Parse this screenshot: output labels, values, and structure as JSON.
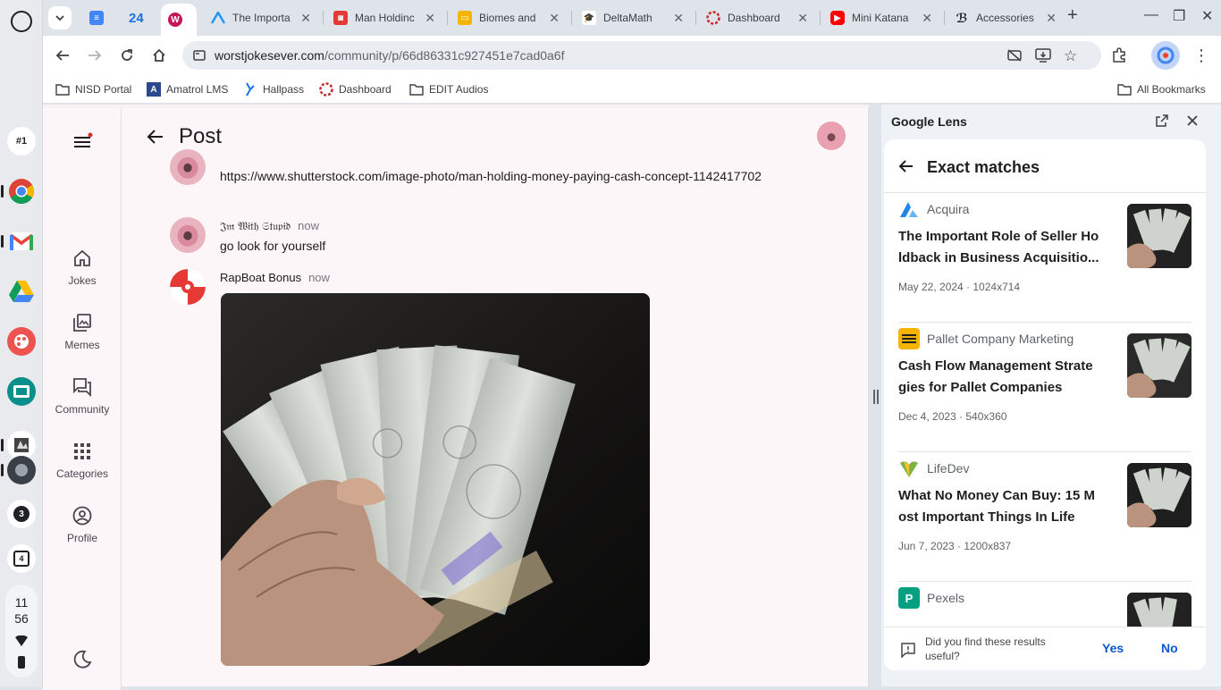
{
  "shelf": {
    "apps": [
      "launcher",
      "notification-badge",
      "chrome",
      "gmail",
      "google-drive",
      "paint-app",
      "classroom-app",
      "photo-app",
      "badge-3",
      "calendar-4"
    ],
    "badge_1": "#1",
    "badge_3": "3",
    "calendar_day": "4",
    "clock_hour": "11",
    "clock_min": "56"
  },
  "tabs": [
    {
      "title": "",
      "favicon": "docs-icon"
    },
    {
      "title": "24",
      "favicon": ""
    },
    {
      "title": "",
      "favicon": "worstjokes-icon",
      "active": true
    },
    {
      "title": "The Importa",
      "favicon": "acquira-icon"
    },
    {
      "title": "Man Holdinc",
      "favicon": "shutterstock-icon"
    },
    {
      "title": "Biomes and",
      "favicon": "slides-icon"
    },
    {
      "title": "DeltaMath",
      "favicon": "deltamath-icon"
    },
    {
      "title": "Dashboard",
      "favicon": "dashboard-icon"
    },
    {
      "title": "Mini Katana",
      "favicon": "youtube-icon"
    },
    {
      "title": "Accessories",
      "favicon": "accessories-icon"
    }
  ],
  "omnibox": {
    "domain": "worstjokesever.com",
    "path": "/community/p/66d86331c927451e7cad0a6f"
  },
  "bookmarks": [
    {
      "label": "NISD Portal"
    },
    {
      "label": "Amatrol LMS"
    },
    {
      "label": "Hallpass"
    },
    {
      "label": "Dashboard"
    },
    {
      "label": "EDIT Audios"
    }
  ],
  "bookmarks_all": "All Bookmarks",
  "nav": {
    "jokes": "Jokes",
    "memes": "Memes",
    "community": "Community",
    "categories": "Categories",
    "profile": "Profile"
  },
  "post": {
    "title": "Post",
    "messages": [
      {
        "text": "https://www.shutterstock.com/image-photo/man-holding-money-paying-cash-concept-1142417702"
      },
      {
        "author": "𝔍𝔪 𝔚𝔦𝔱𝔥 𝔖𝔱𝔲𝔭𝔦𝔡",
        "time": "now",
        "text": "go look for yourself"
      },
      {
        "author": "RapBoat Bonus",
        "time": "now"
      }
    ]
  },
  "lens": {
    "title": "Google Lens",
    "section": "Exact matches",
    "results": [
      {
        "source": "Acquira",
        "title": "The Important Role of Seller Ho ldback in Business Acquisitio...",
        "meta": "May 22, 2024 · 1024x714"
      },
      {
        "source": "Pallet Company Marketing",
        "title": "Cash Flow Management Strate gies for Pallet Companies",
        "meta": "Dec 4, 2023 · 540x360"
      },
      {
        "source": "LifeDev",
        "title": "What No Money Can Buy: 15 M ost Important Things In Life",
        "meta": "Jun 7, 2023 · 1200x837"
      },
      {
        "source": "Pexels",
        "title": "",
        "meta": ""
      }
    ],
    "feedback_question": "Did you find these results useful?",
    "yes": "Yes",
    "no": "No"
  },
  "colors": {
    "accent_blue": "#0b57d0",
    "page_bg": "#fcf6f8",
    "notification_dot": "#d93025"
  }
}
